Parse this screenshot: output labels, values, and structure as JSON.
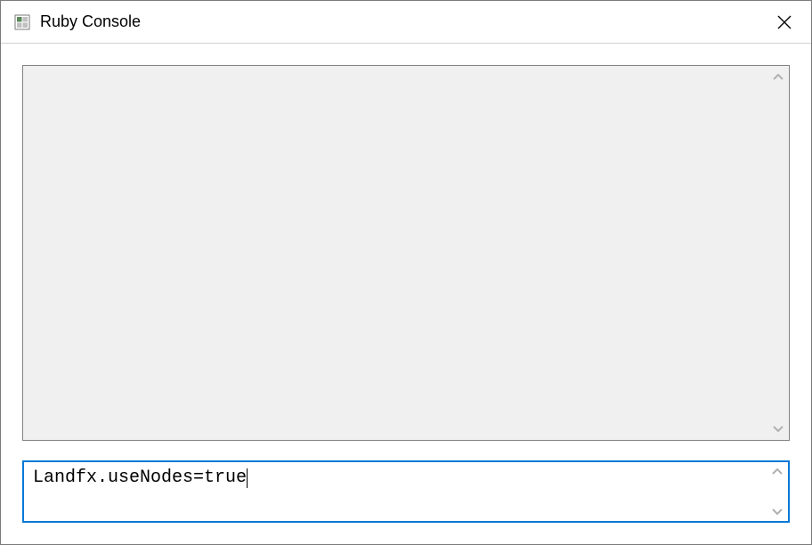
{
  "window": {
    "title": "Ruby Console"
  },
  "output": {
    "content": ""
  },
  "input": {
    "value": "Landfx.useNodes=true"
  }
}
